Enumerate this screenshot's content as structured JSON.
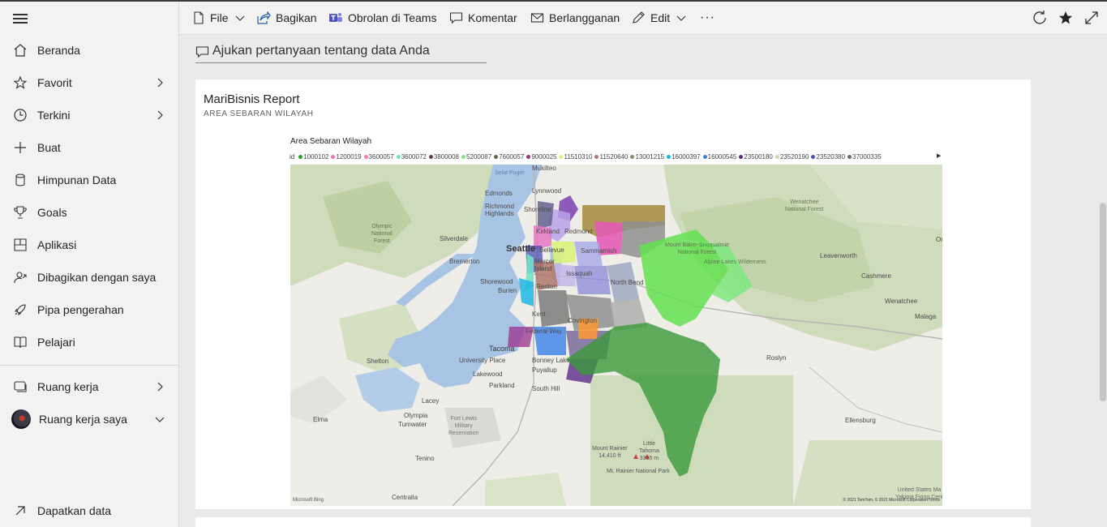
{
  "sidebar": {
    "items": [
      {
        "label": "Beranda",
        "icon": "home-icon"
      },
      {
        "label": "Favorit",
        "icon": "star-icon",
        "chevron": true
      },
      {
        "label": "Terkini",
        "icon": "clock-icon",
        "chevron": true
      },
      {
        "label": "Buat",
        "icon": "plus-icon"
      },
      {
        "label": "Himpunan Data",
        "icon": "database-icon"
      },
      {
        "label": "Goals",
        "icon": "trophy-icon"
      },
      {
        "label": "Aplikasi",
        "icon": "apps-icon"
      },
      {
        "label": "Dibagikan dengan saya",
        "icon": "shared-person-icon"
      },
      {
        "label": "Pipa pengerahan",
        "icon": "rocket-icon"
      },
      {
        "label": "Pelajari",
        "icon": "book-icon"
      }
    ],
    "workspaces": {
      "label": "Ruang kerja",
      "icon": "workspaces-icon"
    },
    "my_workspace": {
      "label": "Ruang kerja saya",
      "icon": "avatar"
    },
    "get_data": {
      "label": "Dapatkan data",
      "icon": "arrow-up-right-icon"
    }
  },
  "toolbar": {
    "file": "File",
    "share": "Bagikan",
    "teams": "Obrolan di Teams",
    "comment": "Komentar",
    "subscribe": "Berlangganan",
    "edit": "Edit",
    "more": "···"
  },
  "qa": {
    "placeholder": "Ajukan pertanyaan tentang data Anda"
  },
  "tile": {
    "title": "MariBisnis Report",
    "subtitle": "AREA SEBARAN WILAYAH",
    "visual_title": "Area Sebaran Wilayah",
    "legend_label": "id",
    "legend": [
      {
        "name": "1000102",
        "color": "#2ca02c"
      },
      {
        "name": "1200019",
        "color": "#e377c2"
      },
      {
        "name": "3600057",
        "color": "#f77fa3"
      },
      {
        "name": "3600072",
        "color": "#6fe3c7"
      },
      {
        "name": "3800008",
        "color": "#6b3a3a"
      },
      {
        "name": "5200087",
        "color": "#7ee87e"
      },
      {
        "name": "7600057",
        "color": "#5c6b3a"
      },
      {
        "name": "9000025",
        "color": "#9c2f8f"
      },
      {
        "name": "11510310",
        "color": "#d9f27a"
      },
      {
        "name": "11520640",
        "color": "#b0776b"
      },
      {
        "name": "13001215",
        "color": "#8e8e54"
      },
      {
        "name": "16000397",
        "color": "#1fb6e8"
      },
      {
        "name": "16000545",
        "color": "#3a7fe8"
      },
      {
        "name": "23500180",
        "color": "#5a2a8a"
      },
      {
        "name": "23520190",
        "color": "#d8d3a8"
      },
      {
        "name": "23520380",
        "color": "#4b4fb0"
      },
      {
        "name": "37000335",
        "color": "#6b6b6b"
      }
    ],
    "places": {
      "mukilteo": "Mukilteo",
      "lynnwood": "Lynnwood",
      "edmonds": "Edmonds",
      "richmond": "Richmond\nHighlands",
      "shoreline": "Shoreline",
      "kirkland": "Kirkland",
      "redmond": "Redmond",
      "bellevue": "Bellevue",
      "seattle": "Seattle",
      "mercer": "Mercer\nIsland",
      "sammamish": "Sammamish",
      "issaquah": "Issaquah",
      "renton": "Renton",
      "burien": "Burien",
      "shorewood": "Shorewood",
      "kent": "Kent",
      "federal_way": "Federal Way",
      "covington": "Covington",
      "north_bend": "North Bend",
      "tacoma": "Tacoma",
      "university_place": "University Place",
      "bonney_lake": "Bonney Lake",
      "puyallup": "Puyallup",
      "lakewood": "Lakewood",
      "parkland": "Parkland",
      "south_hill": "South Hill",
      "silverdale": "Silverdale",
      "bremerton": "Bremerton",
      "shelton": "Shelton",
      "lacey": "Lacey",
      "olympia": "Olympia",
      "tumwater": "Tumwater",
      "elma": "Elma",
      "tenino": "Tenino",
      "centralia": "Centralia",
      "roslyn": "Roslyn",
      "cashmere": "Cashmere",
      "wenatchee": "Wenatchee",
      "leavenworth": "Leavenworth",
      "malaga": "Malaga",
      "ellensburg": "Ellensburg",
      "selat_puget": "Selat\nPuget",
      "olympic_nf": "Olympic\nNational\nForest",
      "mbs_nf": "Mount Baker-Snoqualmie\nNational Forest",
      "alpine": "Alpine Lakes Wilderness",
      "wenatchee_nf": "Wenatchee\nNational Forest",
      "fort_lewis": "Fort Lewis\nMilitary\nReservation",
      "mt_rainier": "Mount Rainier\n14,410 ft",
      "little_tahoma": "Little\nTahoma\n3395 m",
      "mt_rainier_np": "Mt. Rainier National Park",
      "us_res": "United States Ma\nYakima Firing Cent",
      "oro": "Oro"
    },
    "bing": "Microsoft Bing",
    "copyright": "© 2021 TomTom, © 2021 Microsoft Corporation  Terms"
  }
}
